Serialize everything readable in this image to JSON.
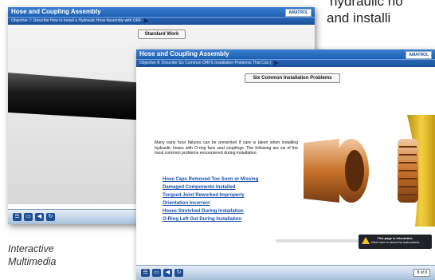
{
  "background_text": {
    "line1": "hydraulic ho",
    "line2": "and installi"
  },
  "caption": {
    "line1": "Interactive",
    "line2": "Multimedia"
  },
  "window_back": {
    "title": "Hose and Coupling Assembly",
    "objective": "Objective 7: Describe How to Install a Hydraulic Hose Assembly with ORF",
    "logo": "AMATROL",
    "top_button": "Standard Work"
  },
  "window_front": {
    "title": "Hose and Coupling Assembly",
    "objective": "Objective 8: Describe Six Common ORFS Installation Problems That Can (",
    "logo": "AMATROL",
    "top_button": "Six Common Installation Problems",
    "paragraph": "Many early hour failures can be prevented if care is taken when installing hydraulic hoses with O-ring face seal couplings. The following are six of the most common problems encountered during installation:",
    "problems": [
      "Hose Caps Removed Too Soon or Missing",
      "Damaged Components Installed",
      "Torqued Joint Reworked Improperly",
      "Orientation Incorrect",
      "Hoses Stretched During Installation",
      "O-Ring Left Out During Installation"
    ],
    "notice_line1": "This page is interactive.",
    "notice_line2": "Click here to show the instructions",
    "pager": "8 of 8"
  },
  "colors": {
    "title_blue": "#1e5fb0",
    "link_blue": "#1a4fa8",
    "copper": "#c8732a"
  }
}
